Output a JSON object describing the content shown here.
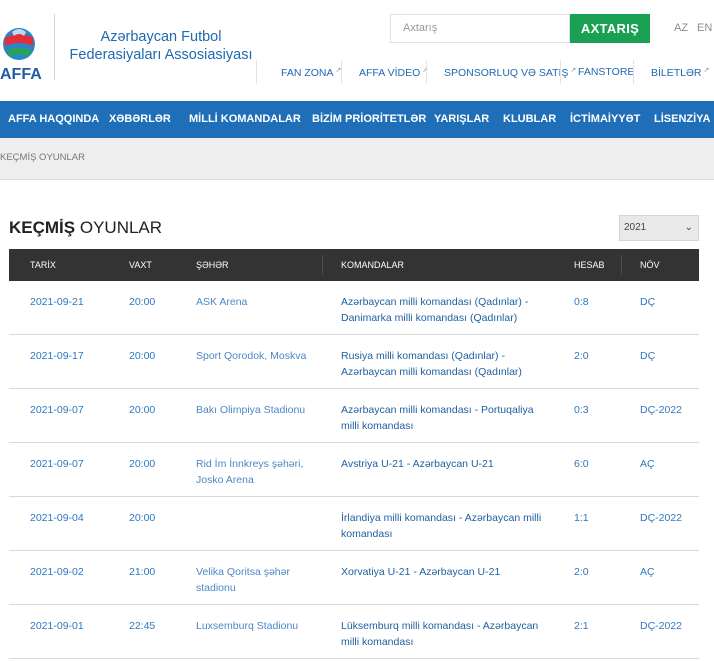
{
  "header": {
    "logo_text": "AFFA",
    "org_name_line1": "Azərbaycan Futbol",
    "org_name_line2": "Federasiyaları Assosiasiyası",
    "search_placeholder": "Axtarış",
    "search_button": "AXTARIŞ",
    "languages": [
      "AZ",
      "EN"
    ],
    "top_nav": [
      {
        "label": "FAN ZONA",
        "external": true
      },
      {
        "label": "AFFA VİDEO",
        "external": true
      },
      {
        "label": "SPONSORLUQ VƏ SATIŞ",
        "external": true
      },
      {
        "label": "FANSTORE",
        "external": false
      },
      {
        "label": "BİLETLƏR",
        "external": true
      }
    ],
    "external_mark": "↗"
  },
  "main_nav": [
    "AFFA HAQQINDA",
    "XƏBƏRLƏR",
    "MİLLİ KOMANDALAR",
    "BİZİM PRİORİTETLƏR",
    "YARIŞLAR",
    "KLUBLAR",
    "İCTİMAİYYƏT",
    "LİSENZİYA"
  ],
  "breadcrumb": "KEÇMİŞ OYUNLAR",
  "page": {
    "title_bold": "KEÇMİŞ",
    "title_rest": "OYUNLAR",
    "year_selected": "2021",
    "caret": "⌄"
  },
  "table": {
    "headers": {
      "date": "TARİX",
      "time": "VAXT",
      "city": "ŞƏHƏR",
      "teams": "KOMANDALAR",
      "score": "HESAB",
      "type": "NÖV"
    },
    "rows": [
      {
        "date": "2021-09-21",
        "time": "20:00",
        "city": "ASK Arena",
        "teams": "Azərbaycan milli komandası (Qadınlar) - Danimarka milli komandası (Qadınlar)",
        "score": "0:8",
        "type": "DÇ"
      },
      {
        "date": "2021-09-17",
        "time": "20:00",
        "city": "Sport Qorodok, Moskva",
        "teams": "Rusiya milli komandası (Qadınlar) - Azərbaycan milli komandası (Qadınlar)",
        "score": "2:0",
        "type": "DÇ"
      },
      {
        "date": "2021-09-07",
        "time": "20:00",
        "city": "Bakı Olimpiya Stadionu",
        "teams": "Azərbaycan milli komandası - Portuqaliya milli komandası",
        "score": "0:3",
        "type": "DÇ-2022"
      },
      {
        "date": "2021-09-07",
        "time": "20:00",
        "city": "Rid İm İnnkreys şəhəri, Josko Arena",
        "teams": "Avstriya U-21 - Azərbaycan U-21",
        "score": "6:0",
        "type": "AÇ"
      },
      {
        "date": "2021-09-04",
        "time": "20:00",
        "city": "",
        "teams": "İrlandiya milli komandası - Azərbaycan milli komandası",
        "score": "1:1",
        "type": "DÇ-2022"
      },
      {
        "date": "2021-09-02",
        "time": "21:00",
        "city": "Velika Qoritsa şəhər stadionu",
        "teams": "Xorvatiya U-21 - Azərbaycan U-21",
        "score": "2:0",
        "type": "AÇ"
      },
      {
        "date": "2021-09-01",
        "time": "22:45",
        "city": "Luxsemburq Stadionu",
        "teams": "Lüksemburq milli komandası - Azərbaycan milli komandası",
        "score": "2:1",
        "type": "DÇ-2022"
      }
    ]
  },
  "colors": {
    "brand_blue": "#1f6fb8",
    "search_green": "#1aa053",
    "table_header": "#333333",
    "link_blue": "#2d79c0"
  }
}
